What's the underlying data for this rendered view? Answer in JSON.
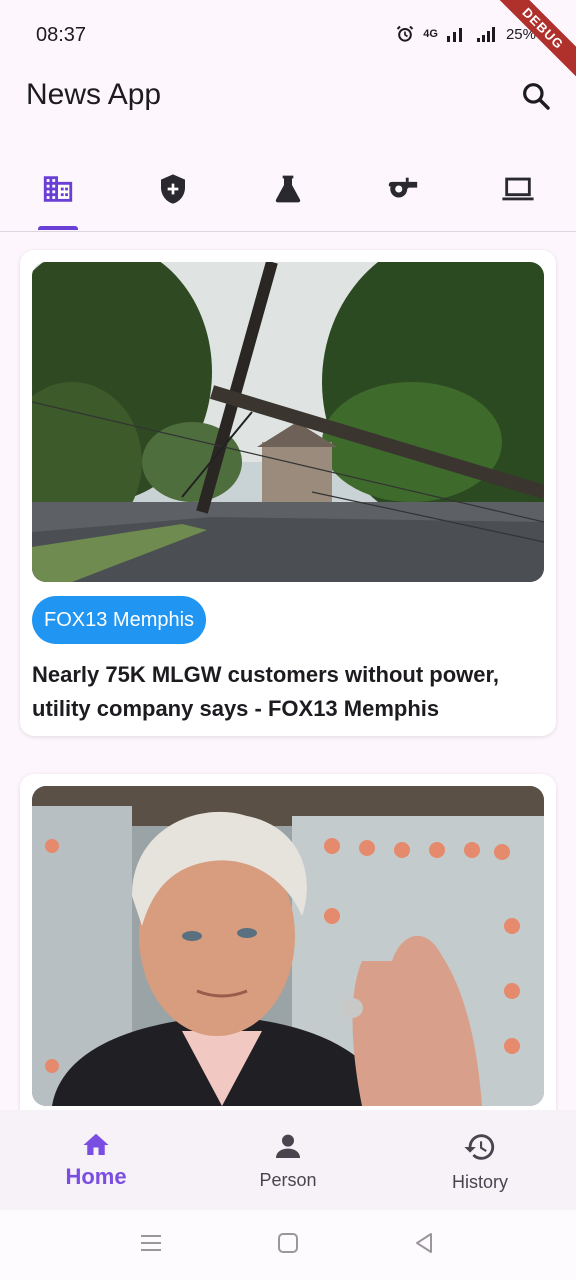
{
  "status": {
    "time": "08:37",
    "signal_label": "4G",
    "battery": "25%",
    "debug_label": "DEBUG"
  },
  "app_bar": {
    "title": "News App",
    "search_icon": "search-icon"
  },
  "tabs": [
    {
      "name": "business",
      "icon": "building-icon",
      "selected": true
    },
    {
      "name": "health",
      "icon": "shield-plus-icon",
      "selected": false
    },
    {
      "name": "science",
      "icon": "flask-icon",
      "selected": false
    },
    {
      "name": "sports",
      "icon": "whistle-icon",
      "selected": false
    },
    {
      "name": "technology",
      "icon": "laptop-icon",
      "selected": false
    }
  ],
  "articles": [
    {
      "source": "FOX13 Memphis",
      "headline": "Nearly 75K MLGW customers without power, utility company says - FOX13 Memphis"
    },
    {
      "source": "",
      "headline": ""
    }
  ],
  "bottom_nav": [
    {
      "label": "Home",
      "icon": "home-icon",
      "active": true
    },
    {
      "label": "Person",
      "icon": "person-icon",
      "active": false
    },
    {
      "label": "History",
      "icon": "history-icon",
      "active": false
    }
  ],
  "colors": {
    "accent": "#7b4ee3",
    "chip": "#2195f2",
    "background": "#fdf7fd"
  }
}
